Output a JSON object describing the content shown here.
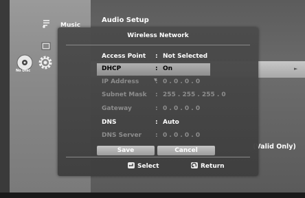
{
  "left_menu": {
    "music_label": "Music",
    "no_disc_label": "No Disc"
  },
  "main": {
    "section_title": "Audio Setup",
    "valid_only_text": "(Valid Only)"
  },
  "dialog": {
    "title": "Wireless Network",
    "rows": [
      {
        "label": "Access Point",
        "colon": ":",
        "value": "Not Selected",
        "state": "on"
      },
      {
        "label": "DHCP",
        "colon": ":",
        "value": "On",
        "state": "selected"
      },
      {
        "label": "IP Address",
        "colon": ":",
        "value": "0 . 0 . 0 . 0",
        "state": "off"
      },
      {
        "label": "Subnet Mask",
        "colon": ":",
        "value": "255 . 255 . 255 . 0",
        "state": "off"
      },
      {
        "label": "Gateway",
        "colon": ":",
        "value": "0 . 0 . 0 . 0",
        "state": "off"
      },
      {
        "label": "DNS",
        "colon": ":",
        "value": "Auto",
        "state": "on"
      },
      {
        "label": "DNS Server",
        "colon": ":",
        "value": "0 . 0 . 0 . 0",
        "state": "off"
      }
    ],
    "save_label": "Save",
    "cancel_label": "Cancel",
    "select_hint": "Select",
    "return_hint": "Return"
  },
  "icons": {
    "music": "music-note-icon",
    "photo": "photo-icon",
    "setup": "gear-icon",
    "disc": "disc-icon",
    "select_key": "enter-key-icon",
    "return_key": "return-key-icon"
  }
}
